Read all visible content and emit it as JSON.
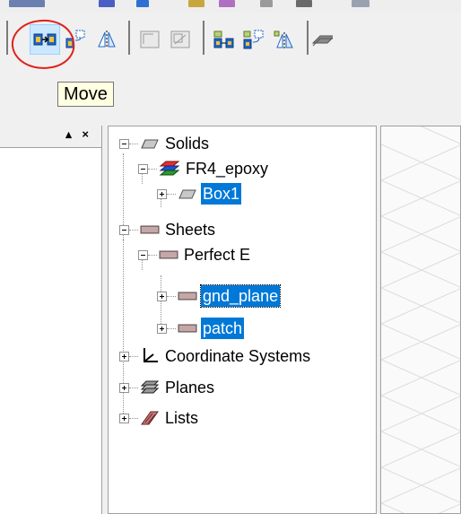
{
  "toolbar": {
    "buttons": [
      {
        "name": "move",
        "icon": "move-icon",
        "active": true
      },
      {
        "name": "rotate",
        "icon": "rotate-icon"
      },
      {
        "name": "mirror",
        "icon": "mirror-icon"
      },
      {
        "name": "offset",
        "icon": "offset-icon"
      },
      {
        "name": "scale",
        "icon": "scale-icon"
      },
      {
        "name": "duplicate-along-line",
        "icon": "duplicate-along-line-icon"
      },
      {
        "name": "duplicate-around-axis",
        "icon": "duplicate-around-axis-icon"
      },
      {
        "name": "duplicate-mirror",
        "icon": "duplicate-mirror-icon"
      },
      {
        "name": "sweep",
        "icon": "sweep-icon"
      }
    ],
    "accent_color": "#cce8ff",
    "highlight_circle_color": "#e0201a"
  },
  "tooltip": {
    "text": "Move"
  },
  "left_panel": {
    "controls": "▴ ×"
  },
  "tree": {
    "solids": {
      "label": "Solids",
      "material": {
        "label": "FR4_epoxy",
        "children": [
          {
            "label": "Box1"
          }
        ]
      }
    },
    "sheets": {
      "label": "Sheets",
      "material": {
        "label": "Perfect E",
        "children": [
          {
            "label": "gnd_plane"
          },
          {
            "label": "patch"
          }
        ]
      }
    },
    "coordinate_systems": {
      "label": "Coordinate Systems"
    },
    "planes": {
      "label": "Planes"
    },
    "lists": {
      "label": "Lists"
    },
    "selection_color": "#0078d7"
  }
}
